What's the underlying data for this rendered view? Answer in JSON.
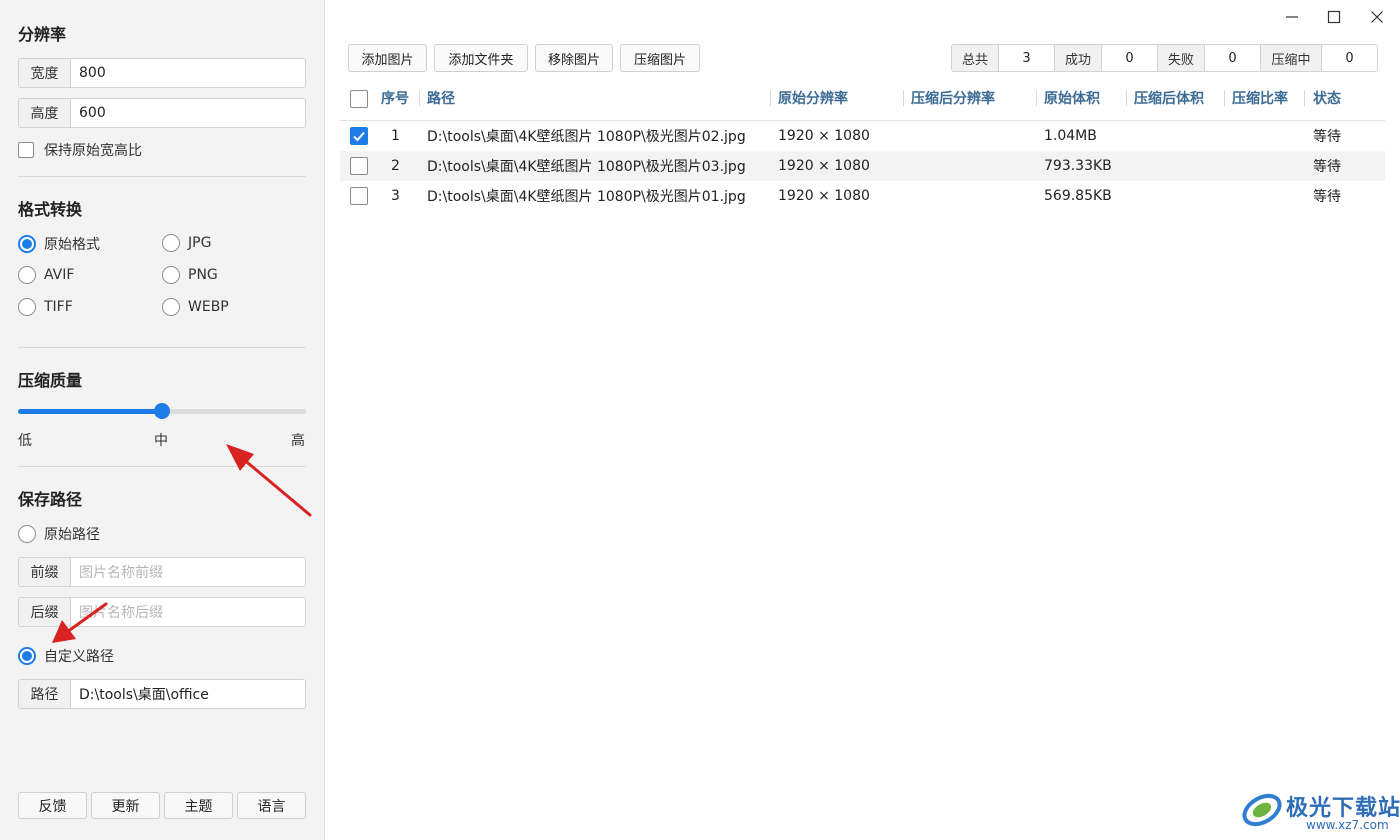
{
  "sidebar": {
    "resolution": {
      "title": "分辨率",
      "width_label": "宽度",
      "width_value": "800",
      "height_label": "高度",
      "height_value": "600",
      "keep_ratio_label": "保持原始宽高比",
      "keep_ratio_checked": false
    },
    "format": {
      "title": "格式转换",
      "options": [
        {
          "label": "原始格式",
          "selected": true
        },
        {
          "label": "JPG",
          "selected": false
        },
        {
          "label": "AVIF",
          "selected": false
        },
        {
          "label": "PNG",
          "selected": false
        },
        {
          "label": "TIFF",
          "selected": false
        },
        {
          "label": "WEBP",
          "selected": false
        }
      ]
    },
    "quality": {
      "title": "压缩质量",
      "level": 0.5,
      "low_label": "低",
      "mid_label": "中",
      "high_label": "高"
    },
    "save_path": {
      "title": "保存路径",
      "original_label": "原始路径",
      "original_selected": false,
      "prefix_label": "前缀",
      "prefix_placeholder": "图片名称前缀",
      "suffix_label": "后缀",
      "suffix_placeholder": "图片名称后缀",
      "custom_label": "自定义路径",
      "custom_selected": true,
      "path_label": "路径",
      "path_value": "D:\\tools\\桌面\\office"
    },
    "bottom_buttons": [
      "反馈",
      "更新",
      "主题",
      "语言"
    ]
  },
  "toolbar": {
    "add_image": "添加图片",
    "add_folder": "添加文件夹",
    "remove_image": "移除图片",
    "compress_image": "压缩图片"
  },
  "stats": {
    "total_label": "总共",
    "total_value": "3",
    "success_label": "成功",
    "success_value": "0",
    "fail_label": "失败",
    "fail_value": "0",
    "compressing_label": "压缩中",
    "compressing_value": "0"
  },
  "table": {
    "headers": {
      "index": "序号",
      "path": "路径",
      "orig_res": "原始分辨率",
      "new_res": "压缩后分辨率",
      "orig_size": "原始体积",
      "new_size": "压缩后体积",
      "ratio": "压缩比率",
      "status": "状态"
    },
    "rows": [
      {
        "checked": true,
        "index": "1",
        "path": "D:\\tools\\桌面\\4K壁纸图片 1080P\\极光图片02.jpg",
        "orig_res": "1920 × 1080",
        "new_res": "",
        "orig_size": "1.04MB",
        "new_size": "",
        "ratio": "",
        "status": "等待"
      },
      {
        "checked": false,
        "index": "2",
        "path": "D:\\tools\\桌面\\4K壁纸图片 1080P\\极光图片03.jpg",
        "orig_res": "1920 × 1080",
        "new_res": "",
        "orig_size": "793.33KB",
        "new_size": "",
        "ratio": "",
        "status": "等待"
      },
      {
        "checked": false,
        "index": "3",
        "path": "D:\\tools\\桌面\\4K壁纸图片 1080P\\极光图片01.jpg",
        "orig_res": "1920 × 1080",
        "new_res": "",
        "orig_size": "569.85KB",
        "new_size": "",
        "ratio": "",
        "status": "等待"
      }
    ]
  },
  "colors": {
    "accent": "#1e7ce8",
    "header_text": "#3d6c95",
    "annotation_arrow": "#d92222"
  },
  "watermark": {
    "text": "极光下载站",
    "url": "www.xz7.com"
  }
}
